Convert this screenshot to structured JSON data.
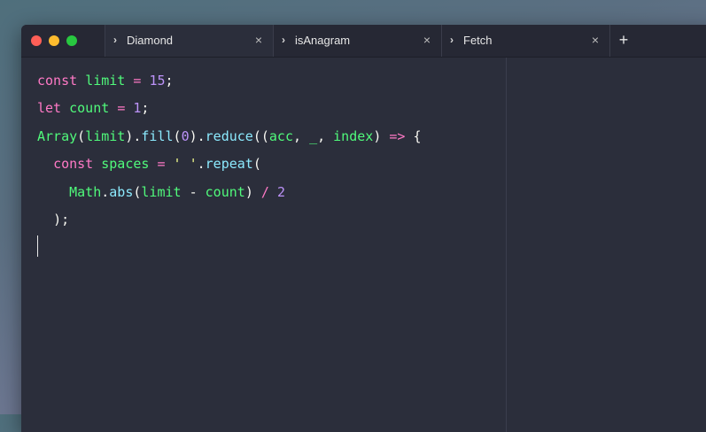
{
  "window": {
    "controls": [
      "close",
      "minimize",
      "zoom"
    ]
  },
  "tabs": [
    {
      "label": "Diamond",
      "active": true,
      "close": "×",
      "chevron": "›"
    },
    {
      "label": "isAnagram",
      "active": false,
      "close": "×",
      "chevron": "›"
    },
    {
      "label": "Fetch",
      "active": false,
      "close": "×",
      "chevron": "›"
    }
  ],
  "new_tab_label": "+",
  "code": {
    "l1": {
      "kw": "const",
      "name": "limit",
      "op": "=",
      "num": "15",
      "end": ";"
    },
    "l2": {
      "kw": "let",
      "name": "count",
      "op": "=",
      "num": "1",
      "end": ";"
    },
    "l3": {
      "a": "Array",
      "b": "(",
      "c": "limit",
      "d": ").",
      "e": "fill",
      "f": "(",
      "g": "0",
      "h": ").",
      "i": "reduce",
      "j": "((",
      "k": "acc",
      "l": ", ",
      "m": "_",
      "n": ", ",
      "o": "index",
      "p": ") ",
      "q": "=>",
      "r": " {"
    },
    "l4": {
      "kw": "const",
      "name": "spaces",
      "op": "=",
      "str": "' '",
      "dot": ".",
      "fn": "repeat",
      "par": "("
    },
    "l5": {
      "a": "Math",
      "b": ".",
      "c": "abs",
      "d": "(",
      "e": "limit",
      "f": " - ",
      "g": "count",
      "h": ") ",
      "i": "/",
      "j": " ",
      "k": "2"
    },
    "l6": {
      "a": ");"
    }
  },
  "colors": {
    "keyword": "#ff79c6",
    "variable": "#50fa7b",
    "number": "#bd93f9",
    "function": "#8be9fd",
    "string": "#f1fa8c",
    "background": "#2b2e3b"
  }
}
